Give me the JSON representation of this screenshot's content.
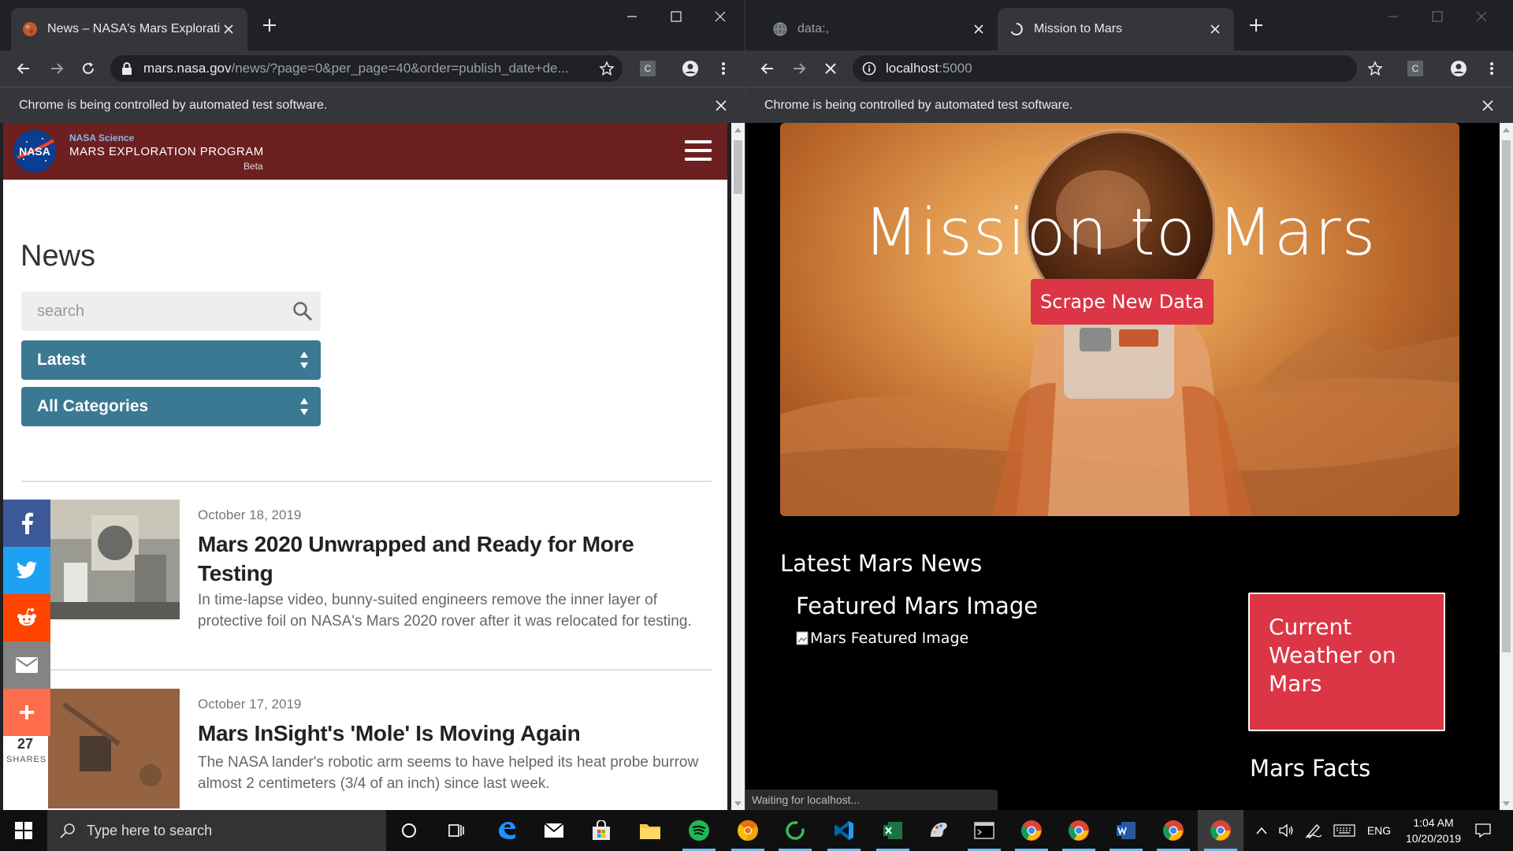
{
  "left_window": {
    "tab_title": "News – NASA's Mars Exploration",
    "url_host": "mars.nasa.gov",
    "url_rest": "/news/?page=0&per_page=40&order=publish_date+de...",
    "profile_letter": "C",
    "infobar_text": "Chrome is being controlled by automated test software.",
    "page": {
      "nasa_logo_text": "NASA",
      "nasa_science": "NASA Science",
      "program": "MARS EXPLORATION PROGRAM",
      "beta": "Beta",
      "news_heading": "News",
      "search_placeholder": "search",
      "sort_select": "Latest",
      "category_select": "All Categories",
      "articles": [
        {
          "date": "October 18, 2019",
          "title": "Mars 2020 Unwrapped and Ready for More Testing",
          "teaser": "In time-lapse video, bunny-suited engineers remove the inner layer of protective foil on NASA's Mars 2020 rover after it was relocated for testing."
        },
        {
          "date": "October 17, 2019",
          "title": "Mars InSight's 'Mole' Is Moving Again",
          "teaser": "The NASA lander's robotic arm seems to have helped its heat probe burrow almost 2 centimeters (3/4 of an inch) since last week."
        }
      ],
      "share_count": "27",
      "share_label": "SHARES",
      "share_colors": {
        "facebook": "#3b5998",
        "twitter": "#1da1f2",
        "reddit": "#ff4500",
        "email": "#848484",
        "more": "#fe6d4c"
      }
    }
  },
  "right_window": {
    "tab1_title": "data:,",
    "tab2_title": "Mission to Mars",
    "url_host": "localhost",
    "url_port": ":5000",
    "profile_letter": "C",
    "infobar_text": "Chrome is being controlled by automated test software.",
    "status_text": "Waiting for localhost...",
    "page": {
      "hero_title": "Mission to Mars",
      "scrape_button": "Scrape New Data",
      "latest_news_heading": "Latest Mars News",
      "featured_image_heading": "Featured Mars Image",
      "featured_image_alt": "Mars Featured Image",
      "weather_heading": "Current Weather on Mars",
      "facts_heading": "Mars Facts",
      "accent_color": "#dc3545"
    }
  },
  "taskbar": {
    "search_placeholder": "Type here to search",
    "apps": [
      "task-view",
      "edge",
      "mail",
      "store",
      "file-explorer",
      "spotify",
      "chrome-canary",
      "cortana-app",
      "vscode",
      "excel",
      "paint",
      "terminal",
      "chrome",
      "chrome",
      "word",
      "chrome",
      "chrome"
    ],
    "language": "ENG",
    "time": "1:04 AM",
    "date": "10/20/2019"
  }
}
